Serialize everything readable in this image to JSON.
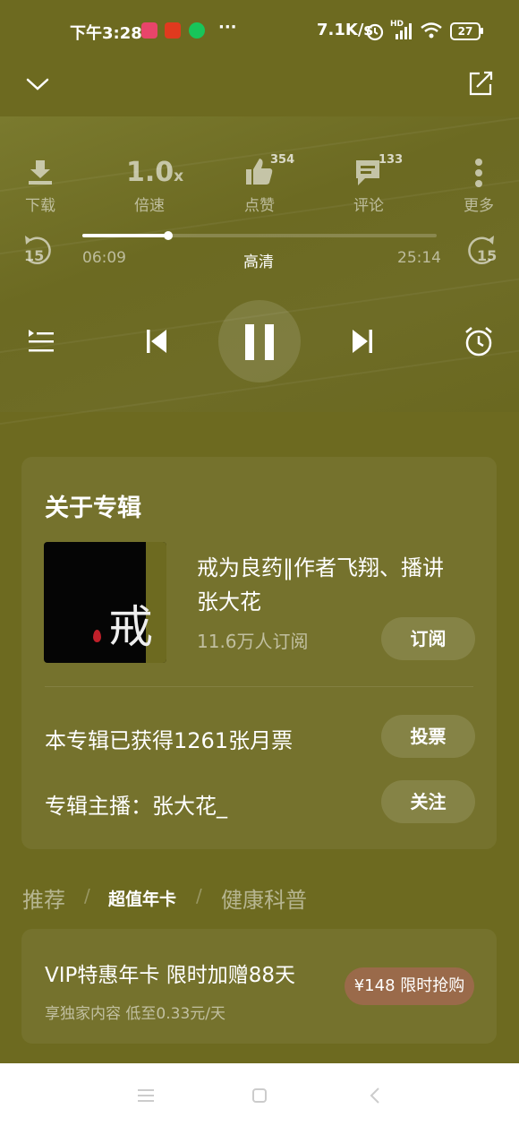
{
  "status_bar": {
    "time": "下午3:28",
    "more": "···",
    "speed": "7.1K/s",
    "hd": "HD",
    "battery": "27"
  },
  "actions": {
    "download": "下载",
    "speed_value": "1.0",
    "speed_unit": "x",
    "speed_label": "倍速",
    "like_label": "点赞",
    "like_count": "354",
    "comment_label": "评论",
    "comment_count": "133",
    "more_label": "更多"
  },
  "player": {
    "rewind": "15",
    "forward": "15",
    "current_time": "06:09",
    "total_time": "25:14",
    "quality": "高清",
    "progress": 0.243
  },
  "album": {
    "section_title": "关于专辑",
    "cover_char": "戒",
    "title_line1": "戒为良药‖作者飞翔、播讲",
    "title_line2": "张大花",
    "subscribers": "11.6万人订阅",
    "subscribe_button": "订阅",
    "tickets_text": "本专辑已获得1261张月票",
    "vote_button": "投票",
    "host_text": "专辑主播：张大花_",
    "follow_button": "关注"
  },
  "tabs": [
    {
      "label": "推荐"
    },
    {
      "label": "超值年卡"
    },
    {
      "label": "健康科普"
    }
  ],
  "vip": {
    "title": "VIP特惠年卡 限时加赠88天",
    "subtitle": "享独家内容 低至0.33元/天",
    "button": "¥148 限时抢购"
  },
  "colors": {
    "background": "#6d6a20",
    "vip_button": "#9a6a4a",
    "cover_red": "#c0202a"
  }
}
